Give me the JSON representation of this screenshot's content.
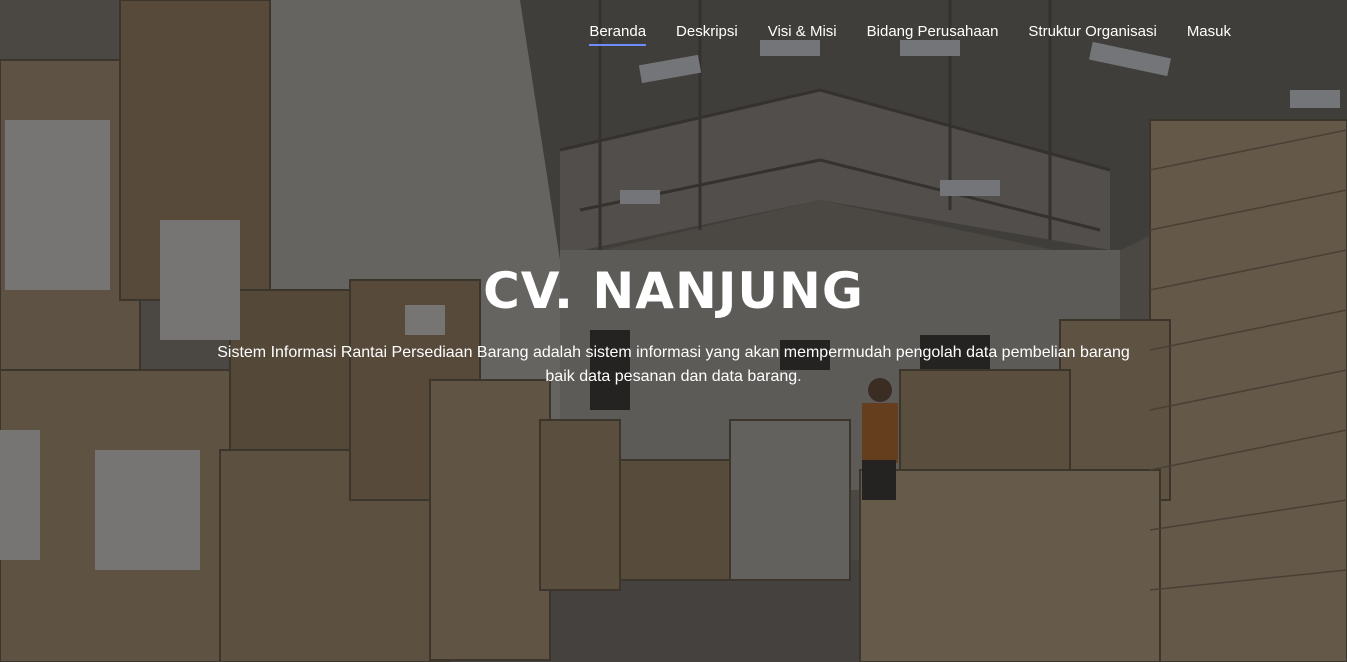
{
  "nav": {
    "items": [
      {
        "label": "Beranda",
        "active": true
      },
      {
        "label": "Deskripsi",
        "active": false
      },
      {
        "label": "Visi & Misi",
        "active": false
      },
      {
        "label": "Bidang Perusahaan",
        "active": false
      },
      {
        "label": "Struktur Organisasi",
        "active": false
      },
      {
        "label": "Masuk",
        "active": false
      }
    ],
    "accent_color": "#6c8dfa"
  },
  "hero": {
    "title": "CV. NANJUNG",
    "description": "Sistem Informasi Rantai Persediaan Barang adalah sistem informasi yang akan mempermudah pengolah data pembelian barang baik data pesanan dan data barang.",
    "background_image": "warehouse-interior-with-stacked-cardboard-boxes"
  }
}
